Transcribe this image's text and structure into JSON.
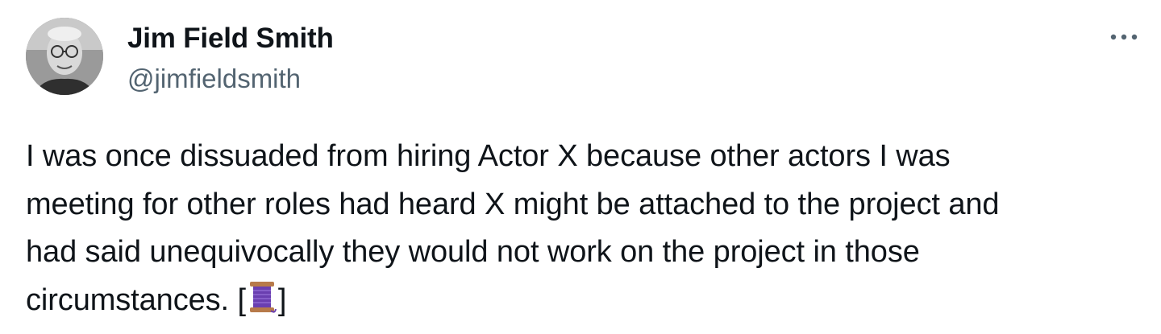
{
  "author": {
    "display_name": "Jim Field Smith",
    "handle": "@jimfieldsmith"
  },
  "tweet": {
    "lines": [
      "I was once dissuaded from hiring Actor X because other actors I was",
      "meeting for other roles had heard X might be attached to the project and",
      "had said unequivocally they would not work on the project in those"
    ],
    "last_line_prefix": "circumstances. [",
    "last_line_suffix": "]",
    "emoji": "thread-spool-icon"
  },
  "icons": {
    "more": "more-options-icon",
    "avatar": "avatar"
  },
  "colors": {
    "text": "#0f1419",
    "secondary": "#536471",
    "spool_thread": "#6a3fb0",
    "spool_wood": "#b77a4a"
  }
}
